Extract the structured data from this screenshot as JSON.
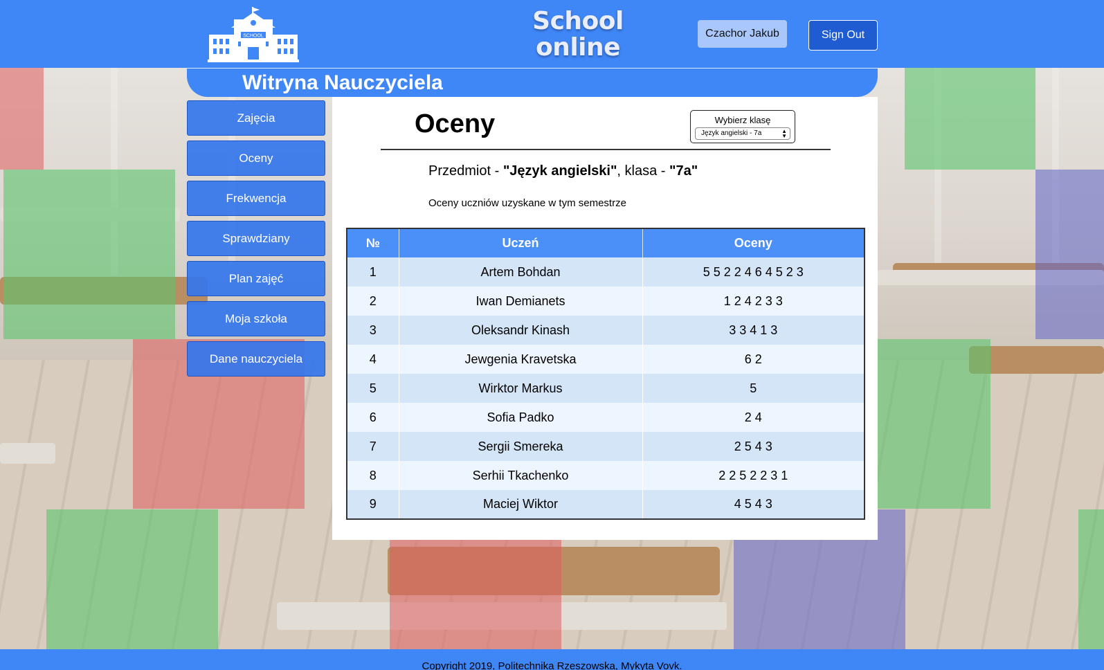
{
  "header": {
    "logo_sign": "SCHOOL",
    "site_title_line1": "School",
    "site_title_line2": "online",
    "user_name": "Czachor Jakub",
    "sign_out_label": "Sign Out"
  },
  "banner": {
    "title": "Witryna Nauczyciela"
  },
  "sidebar": {
    "items": [
      {
        "label": "Zajęcia"
      },
      {
        "label": "Oceny"
      },
      {
        "label": "Frekwencja"
      },
      {
        "label": "Sprawdziany"
      },
      {
        "label": "Plan zajęć"
      },
      {
        "label": "Moja szkoła"
      },
      {
        "label": "Dane nauczyciela"
      }
    ]
  },
  "main": {
    "title": "Oceny",
    "class_select": {
      "label": "Wybierz klasę",
      "selected": "Język angielski - 7a"
    },
    "subject_prefix": "Przedmiot - ",
    "subject": "\"Język angielski\"",
    "class_prefix": ", klasa - ",
    "class_name": "\"7a\"",
    "description": "Oceny uczniów uzyskane w tym semestrze",
    "table": {
      "headers": [
        "№",
        "Uczeń",
        "Oceny"
      ],
      "rows": [
        {
          "num": "1",
          "student": "Artem Bohdan",
          "grades": "5 5 2 2 4 6 4 5 2 3"
        },
        {
          "num": "2",
          "student": "Iwan Demianets",
          "grades": "1 2 4 2 3 3"
        },
        {
          "num": "3",
          "student": "Oleksandr Kinash",
          "grades": "3 3 4 1 3"
        },
        {
          "num": "4",
          "student": "Jewgenia Kravetska",
          "grades": "6 2"
        },
        {
          "num": "5",
          "student": "Wirktor Markus",
          "grades": "5"
        },
        {
          "num": "6",
          "student": "Sofia Padko",
          "grades": "2 4"
        },
        {
          "num": "7",
          "student": "Sergii Smereka",
          "grades": "2 5 4 3"
        },
        {
          "num": "8",
          "student": "Serhii Tkachenko",
          "grades": "2 2 5 2 2 3 1"
        },
        {
          "num": "9",
          "student": "Maciej Wiktor",
          "grades": "4 5 4 3"
        }
      ]
    }
  },
  "footer": {
    "text": "Copyright 2019, Politechnika Rzeszowska, Mykyta Vovk."
  },
  "colors": {
    "header_blue": "#3f86f7",
    "sign_out_blue": "#1f5bd1",
    "table_header": "#4b8ff8",
    "row_odd": "#d4e5f8",
    "row_even": "#edf5fe"
  }
}
